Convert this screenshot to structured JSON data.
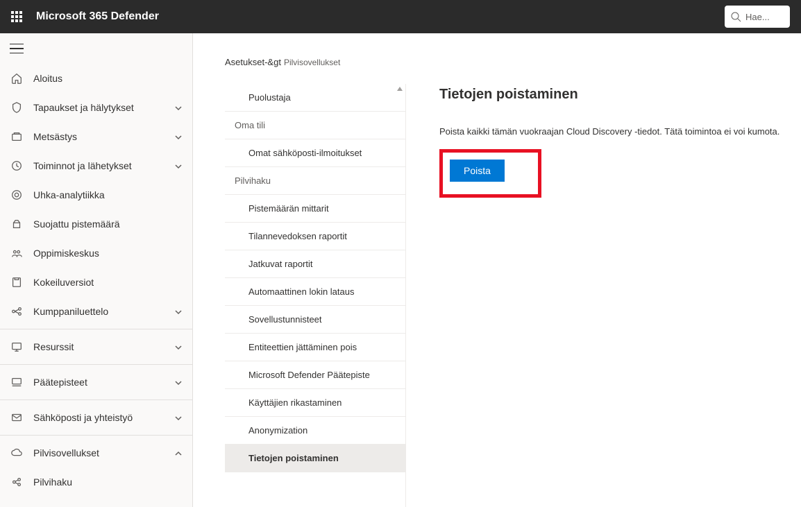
{
  "header": {
    "app_title": "Microsoft 365 Defender",
    "search_placeholder": "Hae..."
  },
  "sidebar": {
    "items": [
      {
        "key": "home",
        "label": "Aloitus",
        "expandable": false
      },
      {
        "key": "incidents",
        "label": "Tapaukset ja hälytykset",
        "expandable": true
      },
      {
        "key": "hunting",
        "label": "Metsästys",
        "expandable": true
      },
      {
        "key": "actions",
        "label": "Toiminnot ja lähetykset",
        "expandable": true
      },
      {
        "key": "threat",
        "label": "Uhka-analytiikka",
        "expandable": false
      },
      {
        "key": "secure",
        "label": "Suojattu pistemäärä",
        "expandable": false
      },
      {
        "key": "learning",
        "label": "Oppimiskeskus",
        "expandable": false
      },
      {
        "key": "trials",
        "label": "Kokeiluversiot",
        "expandable": false
      },
      {
        "key": "partners",
        "label": "Kumppaniluettelo",
        "expandable": true
      },
      {
        "divider": true
      },
      {
        "key": "assets",
        "label": "Resurssit",
        "expandable": true
      },
      {
        "divider": true
      },
      {
        "key": "endpoints",
        "label": "Päätepisteet",
        "expandable": true
      },
      {
        "divider": true
      },
      {
        "key": "email",
        "label": "Sähköposti ja yhteistyö",
        "expandable": true
      },
      {
        "divider": true
      },
      {
        "key": "cloudapps",
        "label": "Pilvisovellukset",
        "expandable": true,
        "expanded": true
      },
      {
        "key": "cloudsearch",
        "label": "Pilvihaku",
        "expandable": false,
        "child": true
      }
    ]
  },
  "breadcrumb": {
    "root": "Asetukset-&gt",
    "current": "Pilvisovellukset"
  },
  "settings_list": [
    {
      "type": "item",
      "label": "Puolustaja",
      "class": "top"
    },
    {
      "type": "header",
      "label": "Oma tili"
    },
    {
      "type": "item",
      "label": "Omat sähköposti-ilmoitukset",
      "class": "indent"
    },
    {
      "type": "header",
      "label": "Pilvihaku"
    },
    {
      "type": "item",
      "label": "Pistemäärän mittarit",
      "class": "indent"
    },
    {
      "type": "item",
      "label": "Tilannevedoksen raportit",
      "class": "indent"
    },
    {
      "type": "item",
      "label": "Jatkuvat raportit",
      "class": "indent"
    },
    {
      "type": "item",
      "label": "Automaattinen lokin lataus",
      "class": "indent"
    },
    {
      "type": "item",
      "label": "Sovellustunnisteet",
      "class": "indent"
    },
    {
      "type": "item",
      "label": "Entiteettien jättäminen pois",
      "class": "indent"
    },
    {
      "type": "item",
      "label": "Microsoft Defender Päätepiste",
      "class": "indent"
    },
    {
      "type": "item",
      "label": "Käyttäjien rikastaminen",
      "class": "indent"
    },
    {
      "type": "item",
      "label": "Anonymization",
      "class": "indent"
    },
    {
      "type": "item",
      "label": "Tietojen poistaminen",
      "class": "indent selected"
    }
  ],
  "detail": {
    "title": "Tietojen poistaminen",
    "description": "Poista kaikki tämän vuokraajan Cloud Discovery -tiedot. Tätä toimintoa ei voi kumota.",
    "button": "Poista"
  }
}
